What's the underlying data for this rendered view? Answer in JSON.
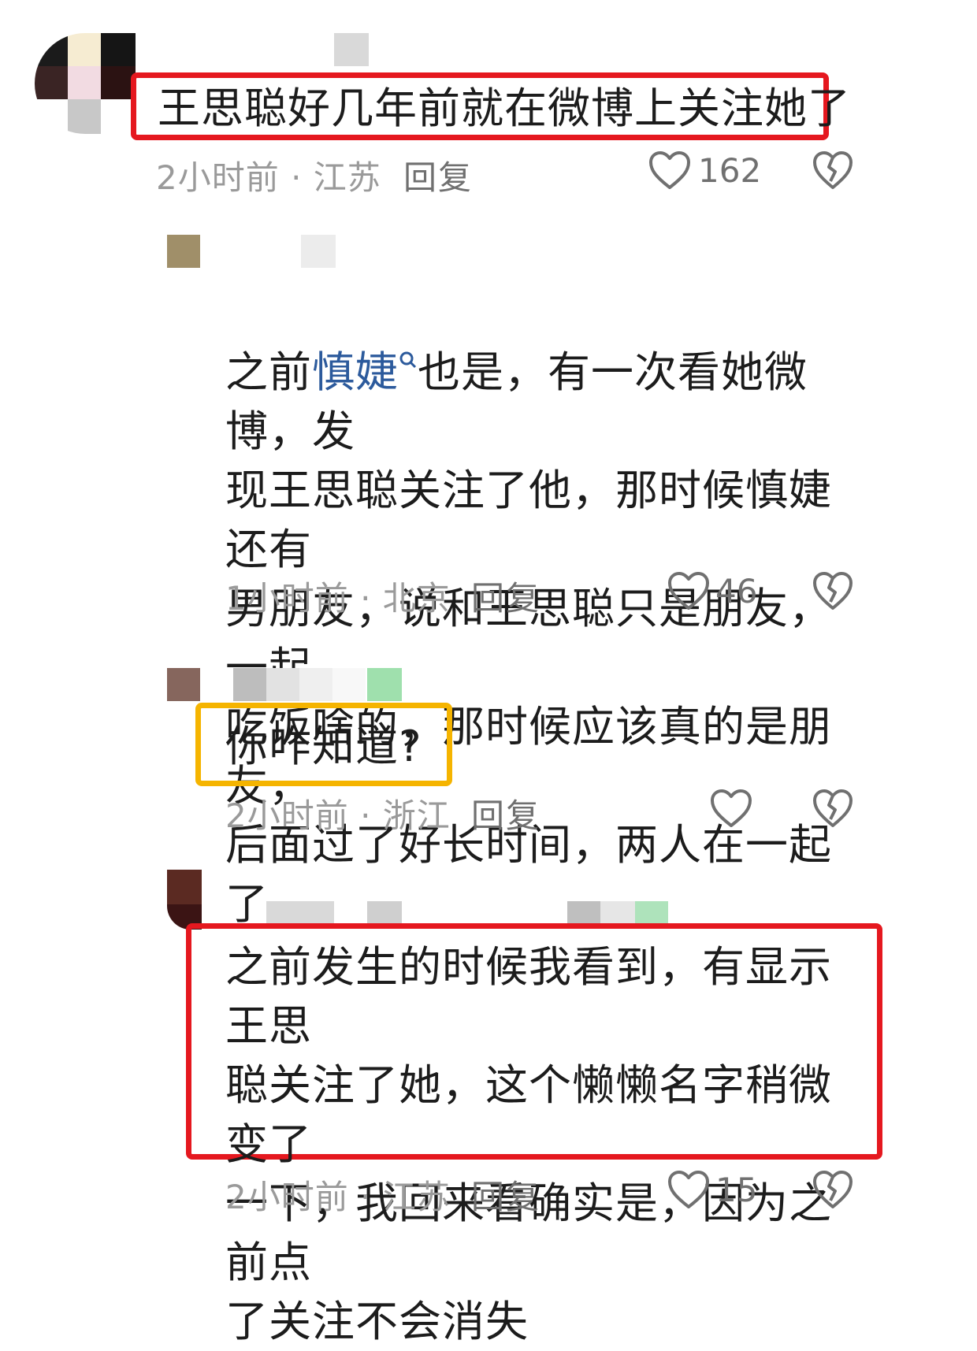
{
  "comments": [
    {
      "text": "王思聪好几年前就在微博上关注她了",
      "time": "2小时前",
      "region": "江苏",
      "reply_label": "回复",
      "likes": "162",
      "highlight": "#e5181f"
    },
    {
      "text_before": "之前",
      "mention": "慎婕",
      "text_after": "也是，有一次看她微博，发\n现王思聪关注了他，那时候慎婕还有\n男朋友，说和王思聪只是朋友，一起\n吃饭啥的，那时候应该真的是朋友，\n后面过了好长时间，两人在一起了",
      "time": "1小时前",
      "region": "北京",
      "reply_label": "回复",
      "likes": "46"
    },
    {
      "text": "你咋知道?",
      "time": "2小时前",
      "region": "浙江",
      "reply_label": "回复",
      "likes": "",
      "highlight": "#f5b400"
    },
    {
      "text": "之前发生的时候我看到，有显示王思\n聪关注了她，这个懒懒名字稍微变了\n一下，我回来看确实是，因为之前点\n了关注不会消失",
      "time": "2小时前",
      "region": "江苏",
      "reply_label": "回复",
      "likes": "15",
      "highlight": "#e5181f"
    }
  ],
  "meta_separator": " · ",
  "icons": {
    "like": "heart-icon",
    "dislike": "broken-heart-icon",
    "search": "search-icon"
  }
}
